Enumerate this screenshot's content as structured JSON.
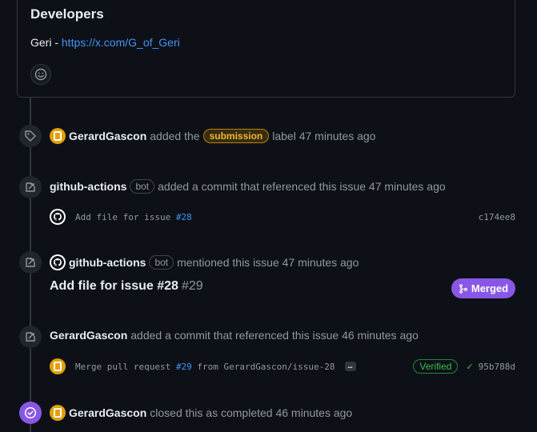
{
  "card": {
    "title": "Developers",
    "text_prefix": "Geri - ",
    "link": "https://x.com/G_of_Geri"
  },
  "events": {
    "label_event": {
      "actor": "GerardGascon",
      "text_before": "added the",
      "label": "submission",
      "text_after": "label 47 minutes ago"
    },
    "commit_event_1": {
      "actor": "github-actions",
      "bot": "bot",
      "text": "added a commit that referenced this issue 47 minutes ago",
      "commit_msg": "Add file for issue ",
      "commit_ref": "#28",
      "sha": "c174ee8"
    },
    "mention_event": {
      "actor": "github-actions",
      "bot": "bot",
      "text": "mentioned this issue 47 minutes ago",
      "pr_title": "Add file for issue #28",
      "pr_number": "#29",
      "status": "Merged"
    },
    "commit_event_2": {
      "actor": "GerardGascon",
      "text": "added a commit that referenced this issue 46 minutes ago",
      "commit_msg_before": "Merge pull request ",
      "commit_ref": "#29",
      "commit_msg_after": " from GerardGascon/issue-28",
      "ellipsis": "…",
      "verified": "Verified",
      "sha": "95b788d"
    },
    "closed_event": {
      "actor": "GerardGascon",
      "text": "closed this as completed 46 minutes ago"
    }
  },
  "colors": {
    "background": "#0d1117",
    "link": "#4493f8",
    "merged": "#8957e5",
    "label": "#f0b72f",
    "verified": "#3fb950"
  }
}
